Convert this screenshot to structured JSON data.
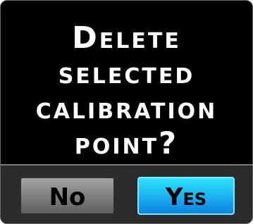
{
  "dialog": {
    "message_lines": [
      "Delete",
      "selected",
      "calibration",
      "point?"
    ]
  },
  "buttons": {
    "no_label": "No",
    "yes_label": "Yes",
    "yes_color": "#1aa8f0",
    "no_color": "#8a8a8a"
  }
}
